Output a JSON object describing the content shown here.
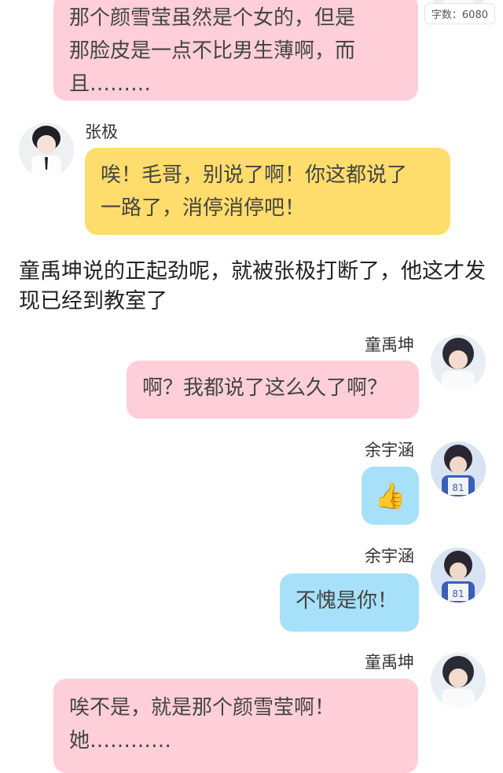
{
  "word_count": "字数：6080",
  "messages": [
    {
      "text": "那个颜雪莹虽然是个女的，但是\n那脸皮是一点不比男生薄啊，而\n且………"
    },
    {
      "name": "张极",
      "text": "唉！毛哥，别说了啊！你这都说了\n一路了，消停消停吧！"
    },
    {
      "name": "童禹坤",
      "text": "啊？我都说了这么久了啊？"
    },
    {
      "name": "余宇涵",
      "text": "👍"
    },
    {
      "name": "余宇涵",
      "text": "不愧是你！"
    },
    {
      "name": "童禹坤",
      "text": "唉不是，就是那个颜雪莹啊！\n她…………"
    }
  ],
  "narration": "童禹坤说的正起劲呢，就被张极打断了，他这才发现已经到教室了",
  "colors": {
    "pink": "#ffcfd9",
    "yellow": "#ffdd6c",
    "blue": "#a6e1f9"
  }
}
